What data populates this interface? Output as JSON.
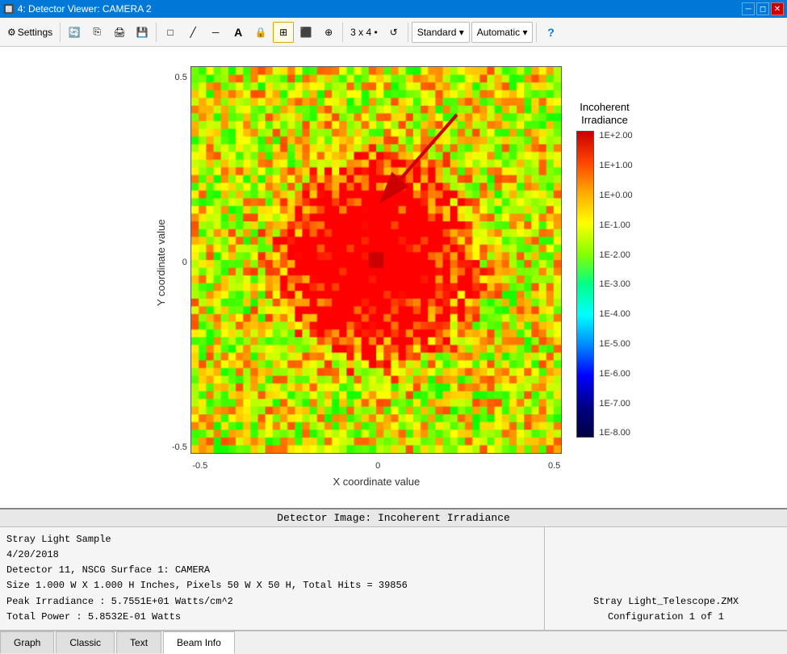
{
  "titleBar": {
    "icon": "4",
    "title": "4: Detector Viewer: CAMERA 2",
    "controls": [
      "minimize",
      "restore",
      "close"
    ]
  },
  "toolbar": {
    "settings_label": "Settings",
    "grid_label": "3 x 4 •",
    "standard_label": "Standard ▾",
    "automatic_label": "Automatic ▾"
  },
  "plot": {
    "yAxisLabel": "Y coordinate value",
    "xAxisLabel": "X coordinate value",
    "yTicks": [
      "0.5",
      "",
      "0",
      "",
      "-0.5"
    ],
    "xTicks": [
      "-0.5",
      "",
      "0",
      "",
      "0.5"
    ],
    "colorbarTitle": "Incoherent\nIrradiance",
    "colorbarTicks": [
      "1E+2.00",
      "1E+1.00",
      "1E+0.00",
      "1E-1.00",
      "1E-2.00",
      "1E-3.00",
      "1E-4.00",
      "1E-5.00",
      "1E-6.00",
      "1E-7.00",
      "1E-8.00"
    ]
  },
  "infoPanel": {
    "title": "Detector Image: Incoherent Irradiance",
    "leftLines": [
      "Stray Light Sample",
      "4/20/2018",
      "Detector 11, NSCG Surface 1: CAMERA",
      "Size 1.000 W X 1.000 H Inches, Pixels 50 W X 50 H, Total Hits = 39856",
      "Peak Irradiance : 5.7551E+01 Watts/cm^2",
      "Total Power     : 5.8532E-01 Watts"
    ],
    "rightLine1": "Stray Light_Telescope.ZMX",
    "rightLine2": "Configuration 1 of 1"
  },
  "tabs": [
    {
      "label": "Graph",
      "active": false
    },
    {
      "label": "Classic",
      "active": false
    },
    {
      "label": "Text",
      "active": false
    },
    {
      "label": "Beam Info",
      "active": true
    }
  ]
}
